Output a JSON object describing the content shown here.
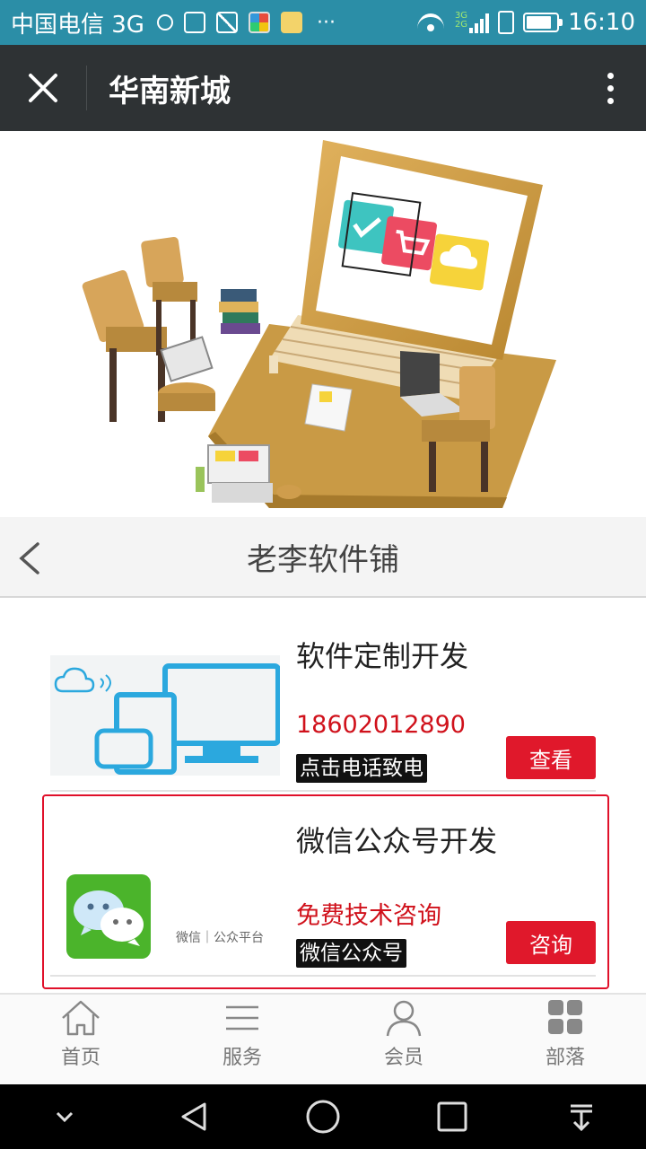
{
  "status_bar": {
    "carrier": "中国电信 3G",
    "network_small_top": "3G",
    "network_small_bottom": "2G",
    "time": "16:10",
    "icons": [
      "chat-bubble-icon",
      "sim-card-icon",
      "image-icon",
      "color-app-icon",
      "camera-app-icon",
      "more-dots-icon",
      "wifi-icon",
      "signal-icon",
      "sim-icon",
      "battery-icon"
    ]
  },
  "app_bar": {
    "title": "华南新城",
    "close_icon": "close-icon",
    "menu_icon": "more-vertical-icon"
  },
  "banner": {
    "icon_colors": [
      "#3ec4c0",
      "#ec4b62",
      "#f6d33a"
    ]
  },
  "shop": {
    "title": "老李软件铺"
  },
  "cards": [
    {
      "name": "软件定制开发",
      "subtitle": "18602012890",
      "tag": "点击电话致电",
      "button": "查看"
    },
    {
      "name": "微信公众号开发",
      "subtitle": "免费技术咨询",
      "tag": "微信公众号",
      "button": "咨询",
      "thumb_label": "微信｜公众平台"
    }
  ],
  "tabs": [
    {
      "label": "首页",
      "icon": "home-icon"
    },
    {
      "label": "服务",
      "icon": "list-icon"
    },
    {
      "label": "会员",
      "icon": "user-icon"
    },
    {
      "label": "部落",
      "icon": "grid-icon"
    }
  ],
  "colors": {
    "status_bar": "#2b8ea7",
    "app_bar": "#2e3234",
    "accent_red": "#e0182b",
    "price_red": "#d0111b"
  }
}
